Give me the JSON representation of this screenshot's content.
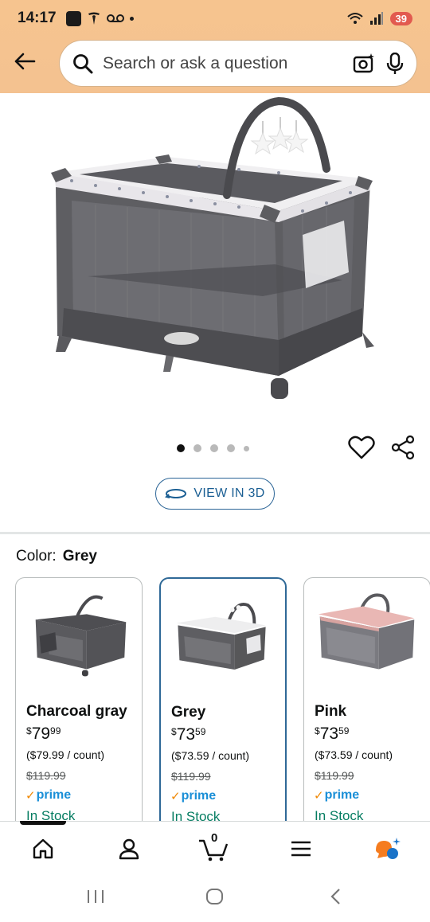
{
  "status_bar": {
    "time": "14:17",
    "battery": "39"
  },
  "search": {
    "placeholder": "Search or ask a question"
  },
  "product": {
    "image_count": 5,
    "active_image": 1,
    "view_3d_label": "VIEW IN 3D"
  },
  "color_selector": {
    "label": "Color:",
    "selected": "Grey",
    "options": [
      {
        "name": "Charcoal gray",
        "price_whole": "79",
        "price_fraction": "99",
        "unit_price": "($79.99 / count)",
        "list_price": "$119.99",
        "prime": "prime",
        "stock": "In Stock"
      },
      {
        "name": "Grey",
        "price_whole": "73",
        "price_fraction": "59",
        "unit_price": "($73.59 / count)",
        "list_price": "$119.99",
        "prime": "prime",
        "stock": "In Stock"
      },
      {
        "name": "Pink",
        "price_whole": "73",
        "price_fraction": "59",
        "unit_price": "($73.59 / count)",
        "list_price": "$119.99",
        "prime": "prime",
        "stock": "In Stock"
      }
    ],
    "currency_symbol": "$"
  },
  "bottom_nav": {
    "cart_count": "0"
  },
  "colors": {
    "header_bg": "#f6c48f",
    "link_blue": "#1a5e93",
    "selected_border": "#2f6997",
    "in_stock_green": "#067d62",
    "prime_blue": "#1a8fd7",
    "prime_check": "#f08804"
  }
}
